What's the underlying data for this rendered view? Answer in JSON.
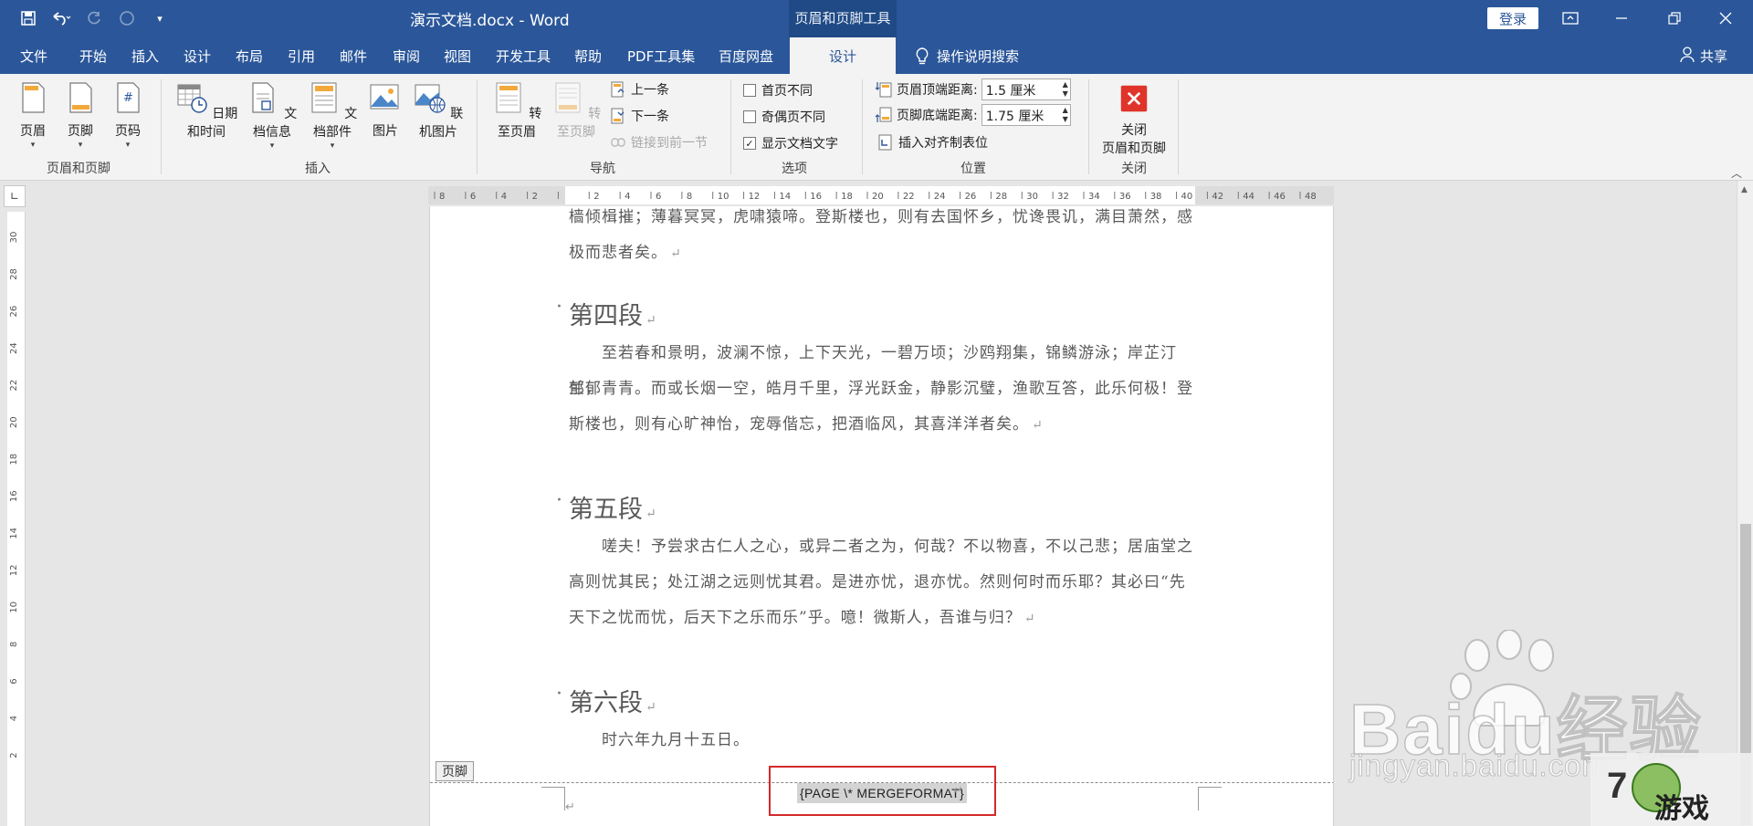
{
  "titlebar": {
    "doc_title": "演示文档.docx  -  Word",
    "context_title": "页眉和页脚工具",
    "login": "登录",
    "qat": [
      "save-icon",
      "undo-icon",
      "redo-icon",
      "circle-icon",
      "customize-qat-icon"
    ]
  },
  "tabs": {
    "items": [
      "文件",
      "开始",
      "插入",
      "设计",
      "布局",
      "引用",
      "邮件",
      "审阅",
      "视图",
      "开发工具",
      "帮助",
      "PDF工具集",
      "百度网盘"
    ],
    "active": "设计",
    "tell_me": "操作说明搜索",
    "share": "共享"
  },
  "ribbon": {
    "header_footer": {
      "label": "页眉和页脚",
      "header": "页眉",
      "footer": "页脚",
      "page_number": "页码"
    },
    "insert": {
      "label": "插入",
      "datetime": "日期和时间",
      "docinfo": "文档信息",
      "quickparts": "文档部件",
      "picture": "图片",
      "online_picture": "联机图片"
    },
    "nav": {
      "label": "导航",
      "goto_header": "转至页眉",
      "goto_footer": "转至页脚",
      "previous": "上一条",
      "next": "下一条",
      "link_previous": "链接到前一节"
    },
    "options": {
      "label": "选项",
      "different_first": "首页不同",
      "different_odd_even": "奇偶页不同",
      "show_doc_text": "显示文档文字",
      "show_doc_text_checked": true
    },
    "position": {
      "label": "位置",
      "header_top_label": "页眉顶端距离:",
      "header_top_value": "1.5 厘米",
      "footer_bottom_label": "页脚底端距离:",
      "footer_bottom_value": "1.75 厘米",
      "insert_align_tab": "插入对齐制表位"
    },
    "close": {
      "label": "关闭",
      "close_line1": "关闭",
      "close_line2": "页眉和页脚",
      "color": "#e0342a"
    }
  },
  "rulers": {
    "horizontal_ticks": [
      "8",
      "6",
      "4",
      "2",
      "",
      "2",
      "4",
      "6",
      "8",
      "10",
      "12",
      "14",
      "16",
      "18",
      "20",
      "22",
      "24",
      "26",
      "28",
      "30",
      "32",
      "34",
      "36",
      "38",
      "40",
      "42",
      "44",
      "46",
      "48"
    ],
    "vertical_ticks": [
      "30",
      "28",
      "26",
      "24",
      "22",
      "20",
      "18",
      "16",
      "14",
      "12",
      "10",
      "8",
      "6",
      "4",
      "2",
      "",
      "2"
    ]
  },
  "document": {
    "top_line1": "樯倾楫摧；薄暮冥冥，虎啸猿啼。登斯楼也，则有去国怀乡，忧谗畏讥，满目萧然，感",
    "top_line2": "极而悲者矣。",
    "heading4": "第四段",
    "p4_line1": "至若春和景明，波澜不惊，上下天光，一碧万顷；沙鸥翔集，锦鳞游泳；岸芷汀兰，",
    "p4_line2": "郁郁青青。而或长烟一空，皓月千里，浮光跃金，静影沉璧，渔歌互答，此乐何极！登",
    "p4_line3": "斯楼也，则有心旷神怡，宠辱偕忘，把酒临风，其喜洋洋者矣。",
    "heading5": "第五段",
    "p5_line1": "嗟夫！予尝求古仁人之心，或异二者之为，何哉？不以物喜，不以己悲；居庙堂之",
    "p5_line2": "高则忧其民；处江湖之远则忧其君。是进亦忧，退亦忧。然则何时而乐耶？其必曰“先",
    "p5_line3": "天下之忧而忧，后天下之乐而乐”乎。噫！微斯人，吾谁与归？",
    "heading6": "第六段",
    "p6_line1": "时六年九月十五日。",
    "return_mark": "↵"
  },
  "footer": {
    "tag": "页脚",
    "field_code": "{PAGE    \\* MERGEFORMAT}"
  },
  "watermark": {
    "text": "Baidu经验",
    "sub": "jingyan.baidu.com",
    "game_logo_text": "游戏"
  }
}
